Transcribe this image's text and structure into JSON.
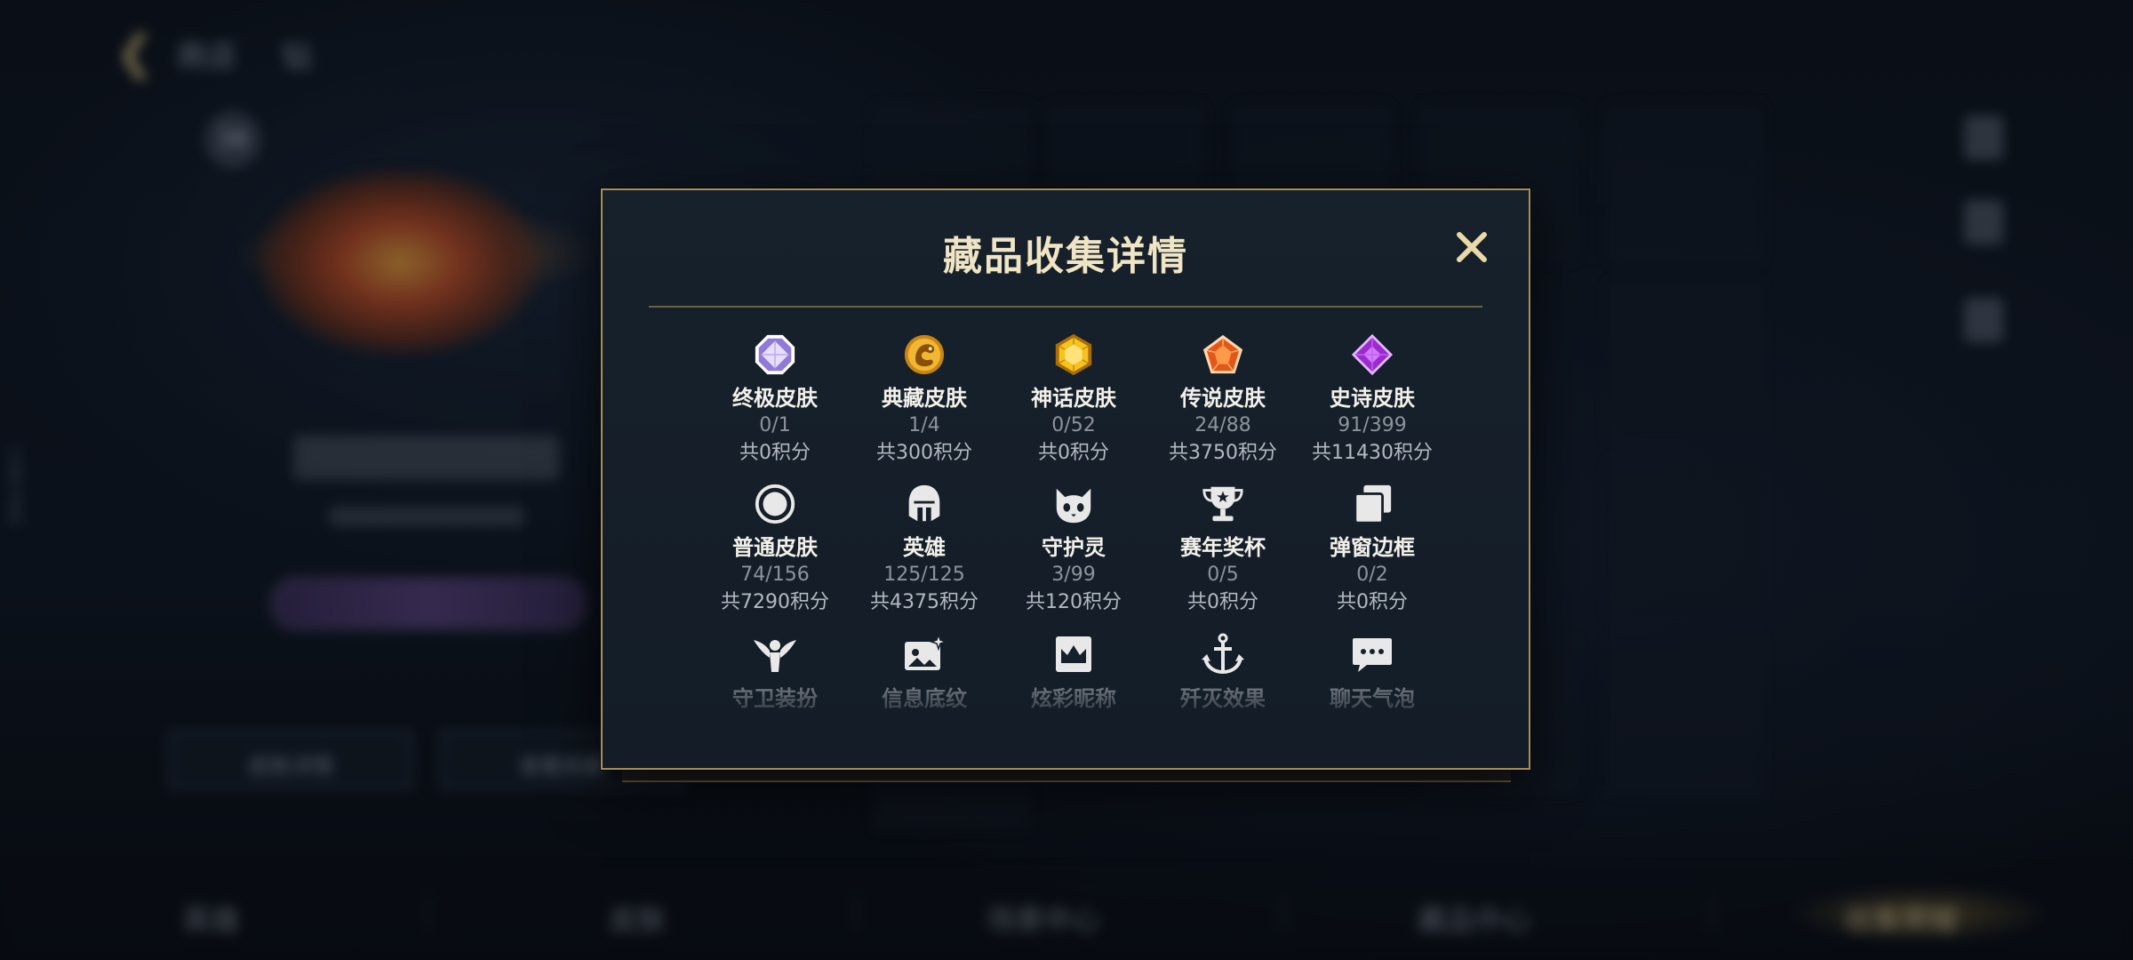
{
  "background": {
    "back_label": "商店",
    "back_extra": "钻",
    "badge": "38",
    "vertical_id": "13867888",
    "buttons": [
      "皮肤详情",
      "查看收藏"
    ],
    "bottom_nav": [
      "英雄",
      "皮肤",
      "场景中心",
      "藏品中心",
      "收集荣耀"
    ]
  },
  "modal": {
    "title": "藏品收集详情",
    "close_label": "✕",
    "items": [
      {
        "name": "终极皮肤",
        "count": "0/1",
        "points": "共0积分",
        "icon": "octagon-gem-icon",
        "color": "#c7b8ff"
      },
      {
        "name": "典藏皮肤",
        "count": "1/4",
        "points": "共300积分",
        "icon": "dragon-coin-icon",
        "color": "#e0a020"
      },
      {
        "name": "神话皮肤",
        "count": "0/52",
        "points": "共0积分",
        "icon": "hexagon-gem-icon",
        "color": "#f0c020"
      },
      {
        "name": "传说皮肤",
        "count": "24/88",
        "points": "共3750积分",
        "icon": "pentagon-gem-icon",
        "color": "#f07a30"
      },
      {
        "name": "史诗皮肤",
        "count": "91/399",
        "points": "共11430积分",
        "icon": "diamond-gem-icon",
        "color": "#b040e0"
      },
      {
        "name": "普通皮肤",
        "count": "74/156",
        "points": "共7290积分",
        "icon": "circle-ring-icon",
        "color": "#e8e8e8"
      },
      {
        "name": "英雄",
        "count": "125/125",
        "points": "共4375积分",
        "icon": "helmet-icon",
        "color": "#e8e8e8"
      },
      {
        "name": "守护灵",
        "count": "3/99",
        "points": "共120积分",
        "icon": "cat-face-icon",
        "color": "#e8e8e8"
      },
      {
        "name": "赛年奖杯",
        "count": "0/5",
        "points": "共0积分",
        "icon": "trophy-icon",
        "color": "#e8e8e8"
      },
      {
        "name": "弹窗边框",
        "count": "0/2",
        "points": "共0积分",
        "icon": "stacked-frames-icon",
        "color": "#e8e8e8"
      },
      {
        "name": "守卫装扮",
        "count": "",
        "points": "",
        "icon": "winged-guard-icon",
        "color": "#e8e8e8"
      },
      {
        "name": "信息底纹",
        "count": "",
        "points": "",
        "icon": "card-sparkle-icon",
        "color": "#e8e8e8"
      },
      {
        "name": "炫彩昵称",
        "count": "",
        "points": "",
        "icon": "crown-card-icon",
        "color": "#e8e8e8"
      },
      {
        "name": "歼灭效果",
        "count": "",
        "points": "",
        "icon": "anchor-icon",
        "color": "#e8e8e8"
      },
      {
        "name": "聊天气泡",
        "count": "",
        "points": "",
        "icon": "chat-bubble-icon",
        "color": "#e8e8e8"
      }
    ]
  }
}
